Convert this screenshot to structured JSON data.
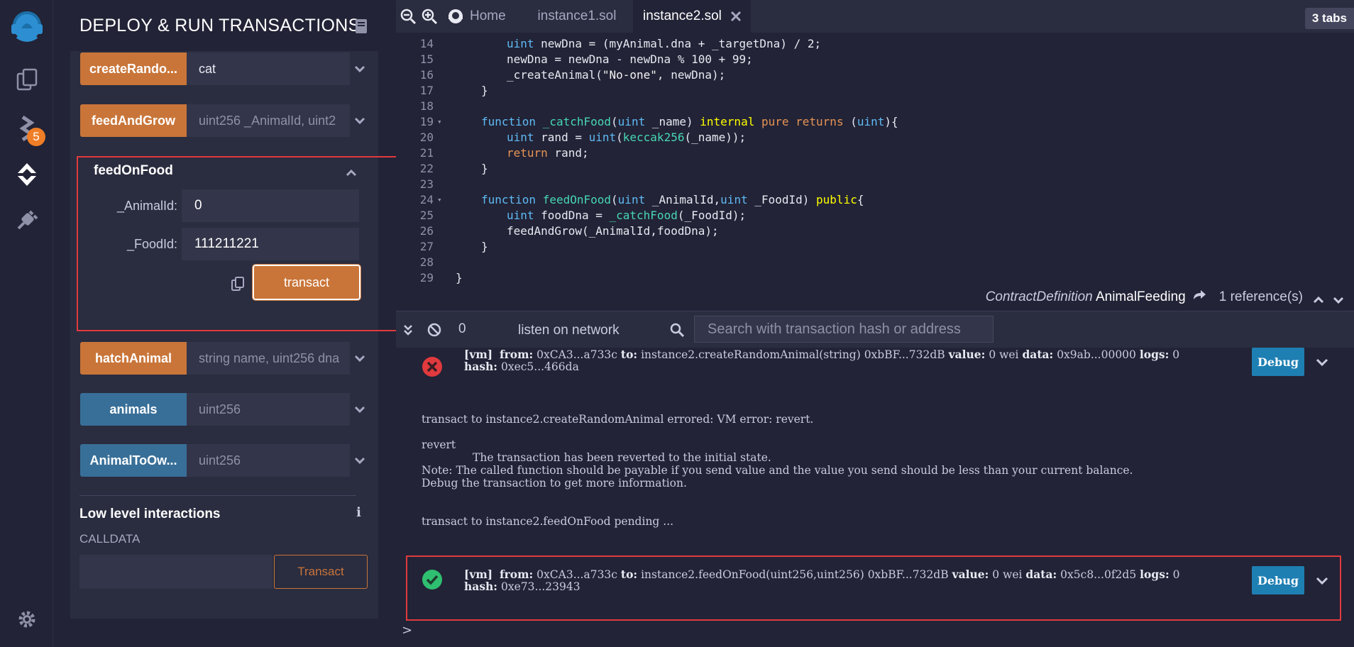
{
  "sidebar_rail": {
    "badge_count": "5",
    "icons": [
      "remix-logo-icon",
      "files-icon",
      "compiler-icon",
      "deploy-icon",
      "plugin-icon",
      "settings-icon"
    ]
  },
  "panel": {
    "title": "DEPLOY & RUN TRANSACTIONS",
    "functions": [
      {
        "label": "createRando...",
        "value": "cat",
        "color": "orange"
      },
      {
        "label": "feedAndGrow",
        "placeholder": "uint256 _AnimalId, uint2",
        "color": "orange"
      },
      {
        "label": "hatchAnimal",
        "placeholder": "string name, uint256 dna",
        "color": "orange"
      },
      {
        "label": "animals",
        "placeholder": "uint256",
        "color": "blue"
      },
      {
        "label": "AnimalToOw...",
        "placeholder": "uint256",
        "color": "blue"
      }
    ],
    "expanded": {
      "title": "feedOnFood",
      "params": [
        {
          "label": "_AnimalId:",
          "value": "0"
        },
        {
          "label": "_FoodId:",
          "value": "111211221"
        }
      ],
      "transact_label": "transact"
    },
    "low_level": {
      "title": "Low level interactions",
      "calldata_label": "CALLDATA",
      "transact_label": "Transact"
    }
  },
  "tabs": {
    "home": "Home",
    "tab1": "instance1.sol",
    "tab2": "instance2.sol",
    "count": "3 tabs"
  },
  "editor": {
    "lines": [
      {
        "n": "14",
        "code": "uint newDna = (myAnimal.dna + _targetDna) / 2;"
      },
      {
        "n": "15",
        "code": "newDna = newDna - newDna % 100 + 99;"
      },
      {
        "n": "16",
        "code": "_createAnimal(\"No-one\", newDna);"
      },
      {
        "n": "17",
        "code": "}"
      },
      {
        "n": "18",
        "code": ""
      },
      {
        "n": "19",
        "code": "function _catchFood(uint _name) internal pure returns (uint){"
      },
      {
        "n": "20",
        "code": "uint rand = uint(keccak256(_name));"
      },
      {
        "n": "21",
        "code": "return rand;"
      },
      {
        "n": "22",
        "code": "}"
      },
      {
        "n": "23",
        "code": ""
      },
      {
        "n": "24",
        "code": "function feedOnFood(uint _AnimalId,uint _FoodId) public{"
      },
      {
        "n": "25",
        "code": "uint foodDna = _catchFood(_FoodId);"
      },
      {
        "n": "26",
        "code": "feedAndGrow(_AnimalId,foodDna);"
      },
      {
        "n": "27",
        "code": "}"
      },
      {
        "n": "28",
        "code": ""
      },
      {
        "n": "29",
        "code": "}"
      }
    ],
    "contract_kind": "ContractDefinition",
    "contract_name": "AnimalFeeding",
    "references": "1 reference(s)"
  },
  "terminal": {
    "pending_count": "0",
    "listen_label": "listen on network",
    "search_placeholder": "Search with transaction hash or address",
    "tx1": {
      "tag": "[vm]",
      "from_label": "from:",
      "from": "0xCA3...a733c",
      "to_label": "to:",
      "to": "instance2.createRandomAnimal(string) 0xbBF...732dB",
      "value_label": "value:",
      "value": "0 wei",
      "data_label": "data:",
      "data": "0x9ab...00000",
      "logs_label": "logs:",
      "logs": "0",
      "hash_label": "hash:",
      "hash": "0xec5...466da",
      "debug": "Debug"
    },
    "error_line": "transact to instance2.createRandomAnimal errored: VM error: revert.",
    "revert": "revert",
    "revert_msg": "The transaction has been reverted to the initial state.",
    "note": "Note: The called function should be payable if you send value and the value you send should be less than your current balance.",
    "debug_hint": "Debug the transaction to get more information.",
    "pending_line": "transact to instance2.feedOnFood pending ...",
    "tx2": {
      "tag": "[vm]",
      "from_label": "from:",
      "from": "0xCA3...a733c",
      "to_label": "to:",
      "to": "instance2.feedOnFood(uint256,uint256) 0xbBF...732dB",
      "value_label": "value:",
      "value": "0 wei",
      "data_label": "data:",
      "data": "0x5c8...0f2d5",
      "logs_label": "logs:",
      "logs": "0",
      "hash_label": "hash:",
      "hash": "0xe73...23943",
      "debug": "Debug"
    },
    "prompt": ">"
  },
  "colors": {
    "accent_orange": "#c97539",
    "accent_blue": "#386f98",
    "highlight_red": "#e03a3e",
    "debug_blue": "#1e7fb3"
  }
}
